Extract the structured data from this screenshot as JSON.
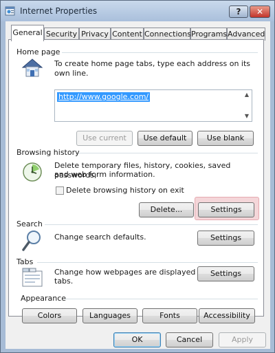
{
  "window": {
    "title": "Internet Properties",
    "help_label": "?",
    "close_label": "✕"
  },
  "tabs": [
    {
      "label": "General",
      "active": true
    },
    {
      "label": "Security"
    },
    {
      "label": "Privacy"
    },
    {
      "label": "Content"
    },
    {
      "label": "Connections"
    },
    {
      "label": "Programs"
    },
    {
      "label": "Advanced"
    }
  ],
  "home_page": {
    "label": "Home page",
    "description": "To create home page tabs, type each address on its own line.",
    "url": "http://www.google.com/",
    "use_current": "Use current",
    "use_default": "Use default",
    "use_blank": "Use blank"
  },
  "browsing_history": {
    "label": "Browsing history",
    "description_line1": "Delete temporary files, history, cookies, saved passwords,",
    "description_line2": "and web form information.",
    "checkbox_label": "Delete browsing history on exit",
    "checkbox_checked": false,
    "delete_button": "Delete...",
    "settings_button": "Settings"
  },
  "search": {
    "label": "Search",
    "description": "Change search defaults.",
    "settings_button": "Settings"
  },
  "tabs_section": {
    "label": "Tabs",
    "description_line1": "Change how webpages are displayed in",
    "description_line2": "tabs.",
    "settings_button": "Settings"
  },
  "appearance": {
    "label": "Appearance",
    "colors": "Colors",
    "languages": "Languages",
    "fonts": "Fonts",
    "accessibility": "Accessibility"
  },
  "footer": {
    "ok": "OK",
    "cancel": "Cancel",
    "apply": "Apply"
  },
  "colors": {
    "accent": "#3399ff",
    "highlight": "#f4d6d9"
  },
  "icons": {
    "app": "internet-properties-icon",
    "home": "house-icon",
    "history": "clock-icon",
    "search": "magnifier-icon",
    "tabs": "tabs-window-icon"
  }
}
